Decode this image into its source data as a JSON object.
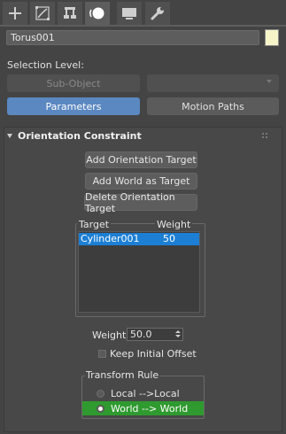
{
  "tabs": [
    {
      "icon": "plus-icon",
      "label": "Create"
    },
    {
      "icon": "curve-edit-icon",
      "label": "Modify"
    },
    {
      "icon": "hierarchy-icon",
      "label": "Hierarchy"
    },
    {
      "icon": "motion-icon",
      "label": "Motion",
      "active": true
    },
    {
      "icon": "display-icon",
      "label": "Display"
    },
    {
      "icon": "wrench-icon",
      "label": "Utilities"
    }
  ],
  "object": {
    "name": "Torus001",
    "color": "#f7f5c8"
  },
  "selection_level": {
    "label": "Selection Level:",
    "sub_object_label": "Sub-Object",
    "dropdown_value": ""
  },
  "mode_buttons": {
    "parameters": "Parameters",
    "motion_paths": "Motion Paths"
  },
  "rollout": {
    "title": "Orientation Constraint",
    "add_orientation_target": "Add Orientation Target",
    "add_world_as_target": "Add World as Target",
    "delete_orientation_target": "Delete Orientation Target",
    "list": {
      "col_target": "Target",
      "col_weight": "Weight",
      "rows": [
        {
          "target": "Cylinder001",
          "weight": "50"
        }
      ]
    },
    "weight_label": "Weight",
    "weight_value": "50.0",
    "keep_initial_offset": "Keep Initial Offset",
    "keep_initial_offset_checked": false,
    "transform_rule": {
      "title": "Transform Rule",
      "options": [
        "Local -->Local",
        "World --> World"
      ],
      "selected": "World --> World"
    }
  },
  "colors": {
    "accent": "#5b88c1",
    "selection": "#1c7fd4",
    "active_option": "#2f9a2f"
  }
}
